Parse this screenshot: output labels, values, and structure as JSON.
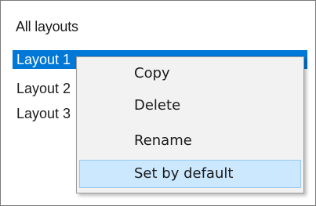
{
  "panel": {
    "title": "All layouts"
  },
  "layouts": [
    {
      "label": "Layout 1",
      "selected": true
    },
    {
      "label": "Layout 2",
      "selected": false
    },
    {
      "label": "Layout 3",
      "selected": false
    }
  ],
  "context_menu": {
    "items": [
      {
        "label": "Copy",
        "highlighted": false
      },
      {
        "label": "Delete",
        "highlighted": false
      },
      {
        "label": "Rename",
        "highlighted": false
      },
      {
        "label": "Set by default",
        "highlighted": true
      }
    ]
  },
  "colors": {
    "selection": "#0078d7",
    "menu_background": "#f2f2f2",
    "menu_hover": "#cce8ff",
    "menu_hover_border": "#99c9ef"
  }
}
